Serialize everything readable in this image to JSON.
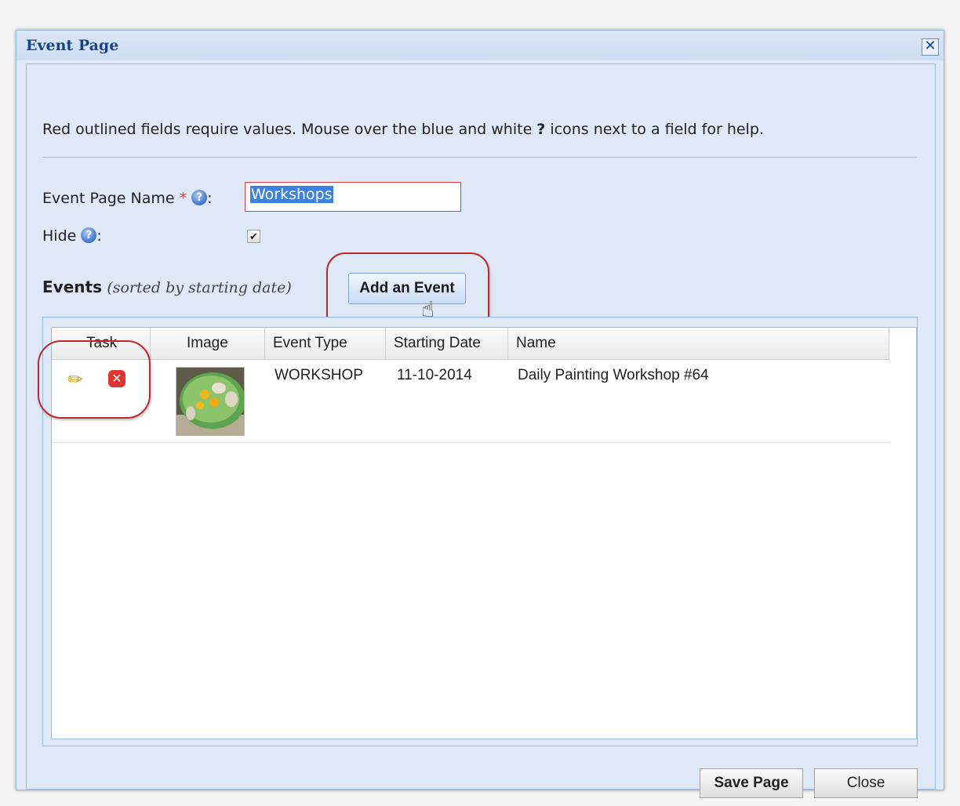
{
  "dialog": {
    "title": "Event Page",
    "close_symbol": "✕"
  },
  "instructions": {
    "text_before": "Red outlined fields require values. Mouse over the blue and white ",
    "bold_symbol": "?",
    "text_after": " icons next to a field for help."
  },
  "form": {
    "name_label": "Event Page Name",
    "required_marker": "*",
    "help_symbol": "?",
    "colon": ":",
    "name_value": "Workshops",
    "hide_label": "Hide",
    "hide_checked": true
  },
  "events": {
    "label": "Events",
    "sort_note": "(sorted by starting date)",
    "add_button": "Add an Event"
  },
  "grid": {
    "columns": [
      "Task",
      "Image",
      "Event Type",
      "Starting Date",
      "Name"
    ],
    "rows": [
      {
        "event_type": "WORKSHOP",
        "starting_date": "11-10-2014",
        "name": "Daily Painting Workshop #64",
        "task_icons": [
          "pencil-icon",
          "delete-icon"
        ],
        "image": "painting-thumbnail"
      }
    ]
  },
  "footer": {
    "save_label": "Save Page",
    "close_label": "Close"
  },
  "colors": {
    "dialog_bg": "#dfe8f6",
    "title_text": "#15428b",
    "required": "#e0393e",
    "highlight_circle": "#c1272d"
  }
}
